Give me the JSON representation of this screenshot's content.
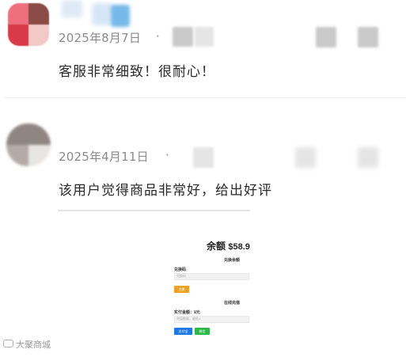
{
  "reviews": [
    {
      "date": "2025年8月7日",
      "separator": "·",
      "comment": "客服非常细致！很耐心！"
    },
    {
      "date": "2025年4月11日",
      "separator": "·",
      "comment": "该用户觉得商品非常好，给出好评"
    }
  ],
  "embedded_screenshot": {
    "title": "余额",
    "amount": "$58.9",
    "section1_title": "兑换余额",
    "field1_label": "兑换码",
    "field1_placeholder": "兑换码",
    "button1_label": "兑换",
    "section2_title": "在线充值",
    "field2_label": "实付金额：¥元",
    "field2_placeholder": "充值数量，最低1",
    "button2_label": "支付宝",
    "button3_label": "微信"
  },
  "watermark": {
    "text": "大聚商城"
  },
  "colors": {
    "date_gray": "#8a8a8a",
    "comment_text": "#2a2a2a",
    "orange_button": "#f0a020",
    "blue_button": "#1e78e6",
    "green_button": "#2fb84a"
  }
}
